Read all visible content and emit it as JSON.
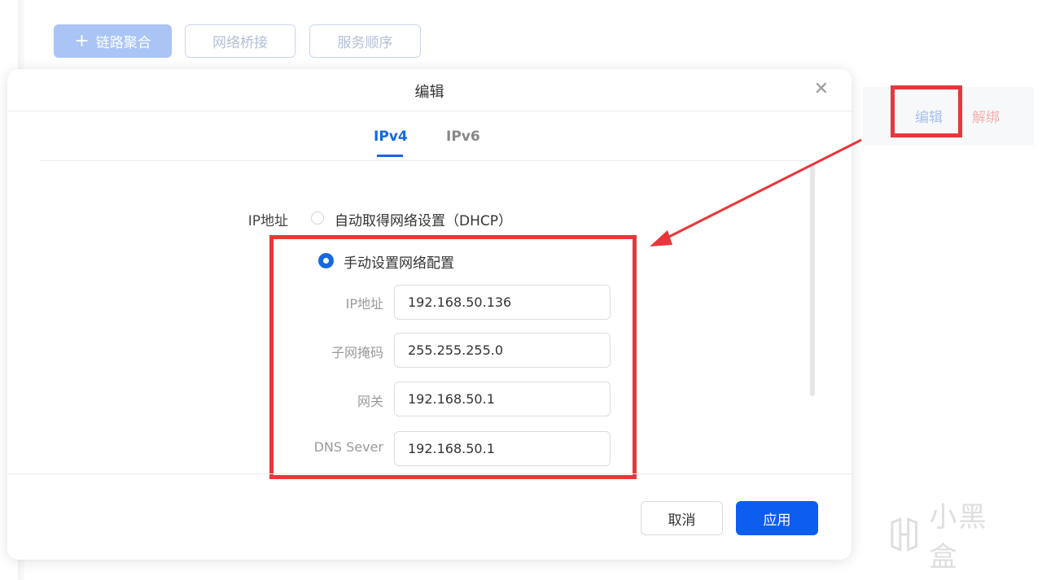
{
  "toolbar": {
    "link_aggregation": "链路聚合",
    "network_bridge": "网络桥接",
    "service_order": "服务顺序"
  },
  "row_actions": {
    "edit": "编辑",
    "unbind": "解绑"
  },
  "dialog": {
    "title": "编辑",
    "tabs": [
      {
        "label": "IPv4",
        "active": true
      },
      {
        "label": "IPv6",
        "active": false
      }
    ],
    "ip_section_label": "IP地址",
    "option_dhcp": "自动取得网络设置（DHCP）",
    "option_manual": "手动设置网络配置",
    "selected_option": "manual",
    "fields": {
      "ip": {
        "label": "IP地址",
        "value": "192.168.50.136"
      },
      "subnet": {
        "label": "子网掩码",
        "value": "255.255.255.0"
      },
      "gateway": {
        "label": "网关",
        "value": "192.168.50.1"
      },
      "dns": {
        "label": "DNS Sever",
        "value": "192.168.50.1"
      }
    },
    "cancel_label": "取消",
    "apply_label": "应用"
  },
  "watermark": {
    "text": "小黑盒"
  },
  "colors": {
    "accent": "#0d5df0",
    "annotation_red": "#e8373a"
  }
}
